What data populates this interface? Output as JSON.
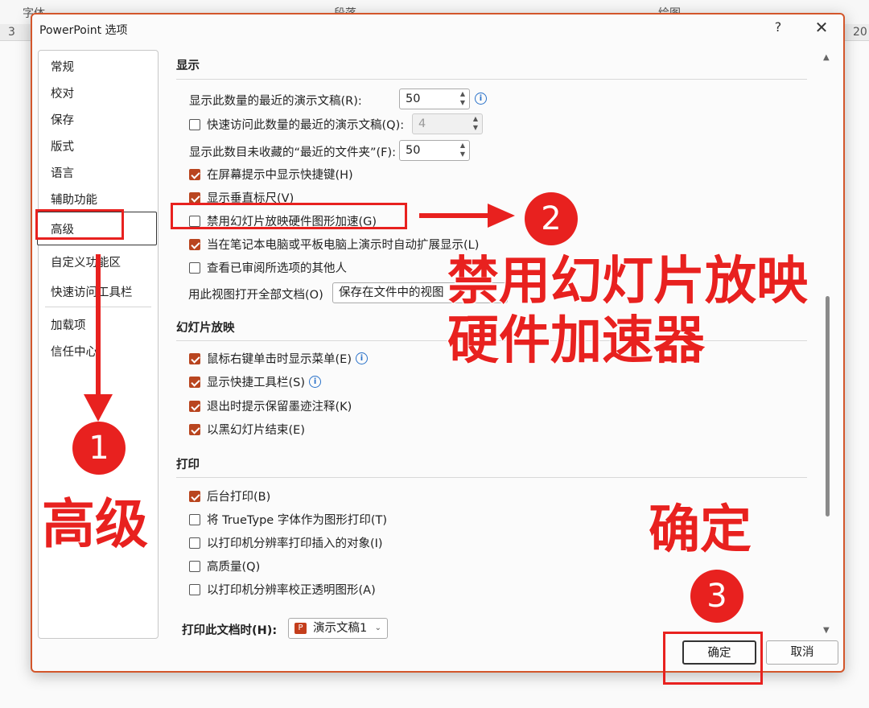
{
  "background": {
    "ribbon_groups": [
      "字体",
      "段落",
      "绘图"
    ],
    "ruler_left": "3",
    "ruler_right": "20"
  },
  "dialog": {
    "title": "PowerPoint 选项",
    "help": "?",
    "close": "✕"
  },
  "nav": {
    "items": [
      "常规",
      "校对",
      "保存",
      "版式",
      "语言",
      "辅助功能",
      "高级",
      "自定义功能区",
      "快速访问工具栏",
      "加载项",
      "信任中心"
    ],
    "selected": "高级"
  },
  "display": {
    "heading": "显示",
    "recent_docs_label": "显示此数量的最近的演示文稿(R):",
    "recent_docs_value": "50",
    "quick_access_label": "快速访问此数量的最近的演示文稿(Q):",
    "quick_access_value": "4",
    "unpinned_folders_label": "显示此数目未收藏的“最近的文件夹”(F):",
    "unpinned_folders_value": "50",
    "show_shortcut_keys": "在屏幕提示中显示快捷键(H)",
    "show_vertical_ruler": "显示垂直标尺(V)",
    "disable_hw_accel": "禁用幻灯片放映硬件图形加速(G)",
    "auto_extend": "当在笔记本电脑或平板电脑上演示时自动扩展显示(L)",
    "show_reviewers": "查看已审阅所选项的其他人",
    "open_view_label": "用此视图打开全部文档(O)",
    "open_view_value": "保存在文件中的视图"
  },
  "slideshow": {
    "heading": "幻灯片放映",
    "right_click_menu": "鼠标右键单击时显示菜单(E)",
    "popup_toolbar": "显示快捷工具栏(S)",
    "keep_ink": "退出时提示保留墨迹注释(K)",
    "end_black": "以黑幻灯片结束(E)"
  },
  "print": {
    "heading": "打印",
    "background_print": "后台打印(B)",
    "truetype_graphics": "将 TrueType 字体作为图形打印(T)",
    "printer_resolution_objects": "以打印机分辨率打印插入的对象(I)",
    "high_quality": "高质量(Q)",
    "align_transparent": "以打印机分辨率校正透明图形(A)",
    "when_printing_label": "打印此文档时(H):",
    "when_printing_value": "演示文稿1"
  },
  "buttons": {
    "ok": "确定",
    "cancel": "取消"
  },
  "annotations": {
    "step1": "1",
    "step2": "2",
    "step3": "3",
    "label1": "高级",
    "label2_line1": "禁用幻灯片放映",
    "label2_line2": "硬件加速器",
    "label3": "确定"
  },
  "colors": {
    "accent": "#b9451f",
    "dialog_border": "#d3562b",
    "annotation_red": "#e8211f",
    "info_blue": "#2a72c9"
  }
}
